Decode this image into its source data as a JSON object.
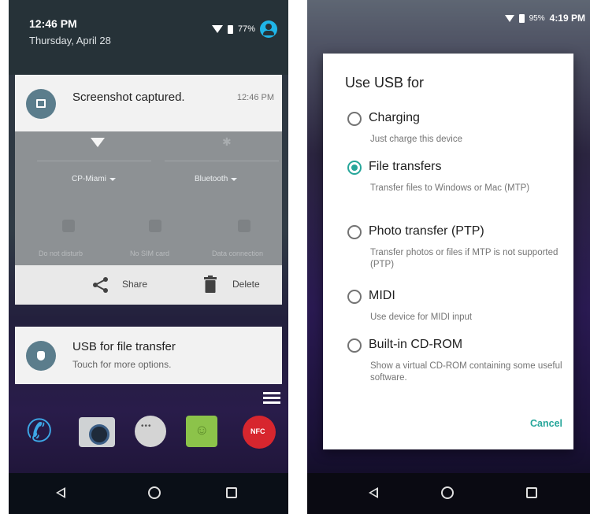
{
  "left_screen": {
    "status_bar": {
      "time": "12:46 PM",
      "date": "Thursday, April 28",
      "battery": "77%"
    },
    "screenshot_notification": {
      "title": "Screenshot captured.",
      "time": "12:46 PM"
    },
    "quick_settings": {
      "wifi_label": "CP-Miami",
      "bluetooth_label": "Bluetooth",
      "dnd_label": "Do not disturb",
      "sim_label": "No SIM card",
      "data_label": "Data connection"
    },
    "actions": {
      "share_label": "Share",
      "delete_label": "Delete"
    },
    "usb_notification": {
      "title": "USB for file transfer",
      "subtitle": "Touch for more options."
    }
  },
  "right_screen": {
    "status_bar": {
      "battery": "95%",
      "time": "4:19 PM"
    },
    "dialog": {
      "title": "Use USB for",
      "options": [
        {
          "label": "Charging",
          "description": "Just charge this device",
          "selected": false
        },
        {
          "label": "File transfers",
          "description": "Transfer files to Windows or Mac (MTP)",
          "selected": true
        },
        {
          "label": "Photo transfer (PTP)",
          "description": "Transfer photos or files if MTP is not supported (PTP)",
          "selected": false
        },
        {
          "label": "MIDI",
          "description": "Use device for MIDI input",
          "selected": false
        },
        {
          "label": "Built-in CD-ROM",
          "description": "Show a virtual CD-ROM containing some useful software.",
          "selected": false
        }
      ],
      "cancel_label": "Cancel"
    }
  },
  "colors": {
    "accent": "#26a69a",
    "header": "#263238",
    "notification_bg": "#f2f2f2"
  }
}
